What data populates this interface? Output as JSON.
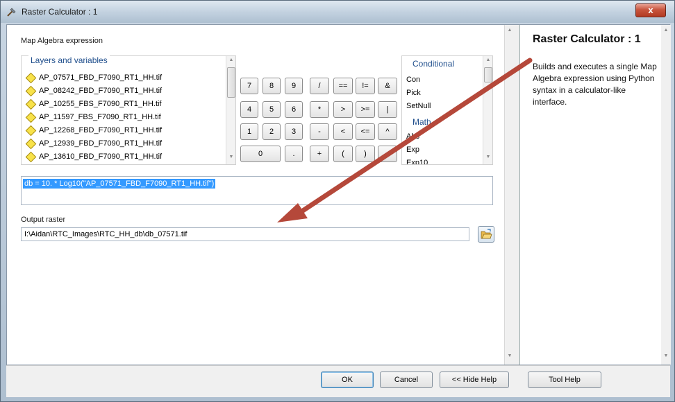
{
  "window": {
    "title": "Raster Calculator : 1",
    "close_glyph": "x"
  },
  "expression_section": {
    "label": "Map Algebra expression"
  },
  "layers": {
    "title": "Layers and variables",
    "items": [
      "AP_07571_FBD_F7090_RT1_HH.tif",
      "AP_08242_FBD_F7090_RT1_HH.tif",
      "AP_10255_FBS_F7090_RT1_HH.tif",
      "AP_11597_FBS_F7090_RT1_HH.tif",
      "AP_12268_FBD_F7090_RT1_HH.tif",
      "AP_12939_FBD_F7090_RT1_HH.tif",
      "AP_13610_FBD_F7090_RT1_HH.tif"
    ]
  },
  "keypad": {
    "row1": [
      "7",
      "8",
      "9",
      "/",
      "==",
      "!=",
      "&"
    ],
    "row2": [
      "4",
      "5",
      "6",
      "*",
      ">",
      ">=",
      "|"
    ],
    "row3": [
      "1",
      "2",
      "3",
      "-",
      "<",
      "<=",
      "^"
    ],
    "row4": [
      "0",
      ".",
      "+",
      "(",
      ")",
      "~"
    ]
  },
  "functions": {
    "title": "Conditional",
    "conditional": [
      "Con",
      "Pick",
      "SetNull"
    ],
    "math_title": "Math",
    "math": [
      "Abs",
      "Exp",
      "Exp10"
    ]
  },
  "expression": {
    "value": "db = 10. * Log10(\"AP_07571_FBD_F7090_RT1_HH.tif\")"
  },
  "output": {
    "label": "Output raster",
    "value": "I:\\Aidan\\RTC_Images\\RTC_HH_db\\db_07571.tif"
  },
  "help": {
    "title": "Raster Calculator : 1",
    "body": "Builds and executes a single Map Algebra expression using Python syntax in a calculator-like interface."
  },
  "buttons": {
    "ok": "OK",
    "cancel": "Cancel",
    "hide_help": "<< Hide Help",
    "tool_help": "Tool Help"
  },
  "colors": {
    "annotation_arrow": "#b5483a",
    "group_title": "#1f4e8c",
    "selection": "#3399ff",
    "layer_icon": "#f8e24a"
  },
  "icons": {
    "title": "hammer-icon",
    "layer": "raster-layer-diamond-icon",
    "browse": "open-folder-icon"
  }
}
